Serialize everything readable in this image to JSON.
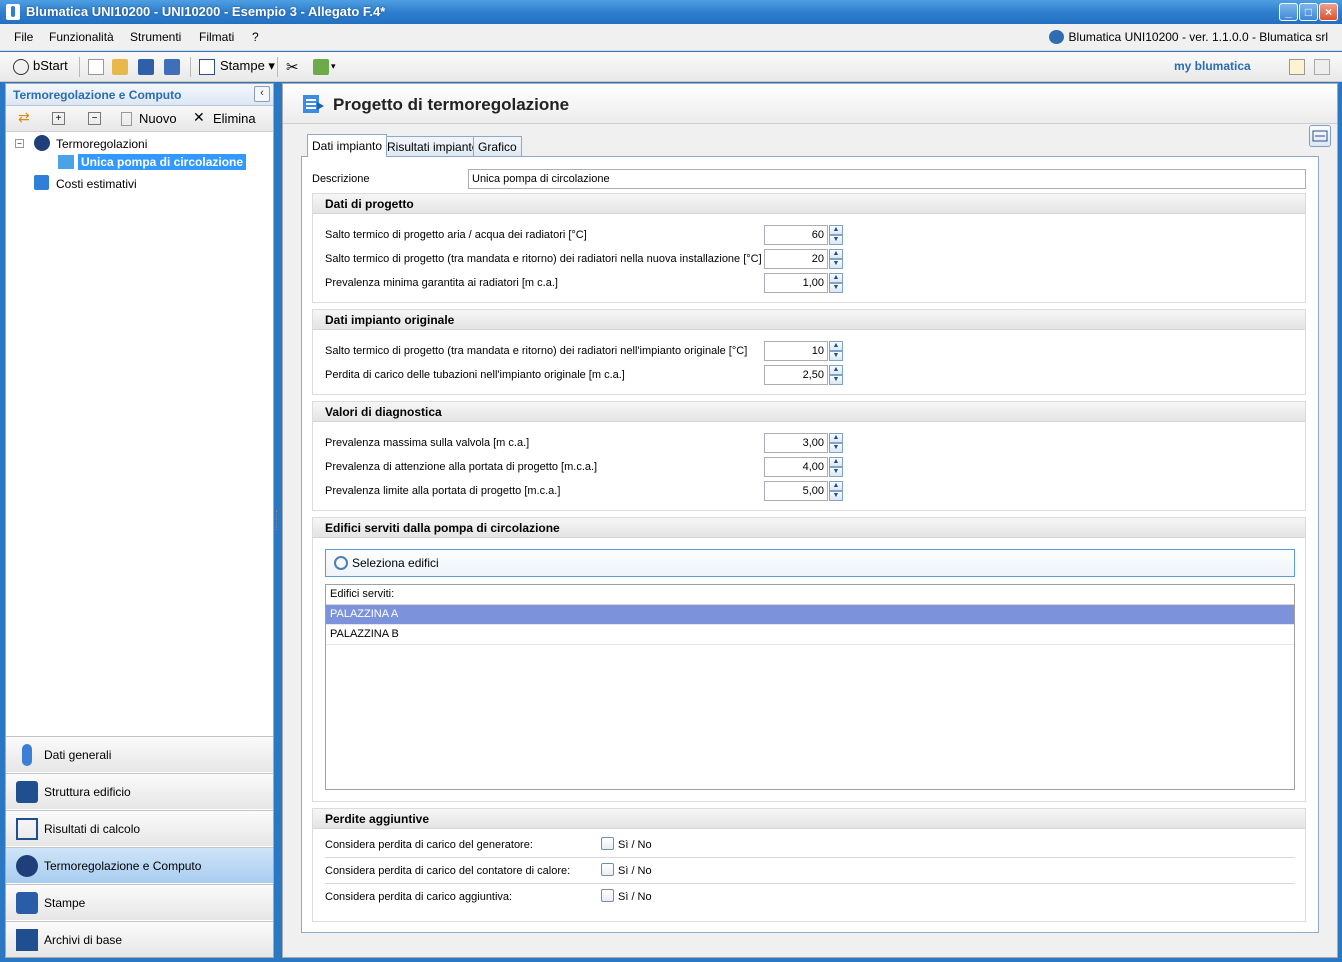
{
  "window": {
    "title": "Blumatica UNI10200 - UNI10200 - Esempio 3 - Allegato F.4*"
  },
  "menu": {
    "items": [
      "File",
      "Funzionalità",
      "Strumenti",
      "Filmati",
      "?"
    ],
    "version": "Blumatica UNI10200 - ver. 1.1.0.0 - Blumatica srl"
  },
  "toolbar": {
    "bstart": "bStart",
    "stampe": "Stampe",
    "brand": "my blumatica"
  },
  "left": {
    "header": "Termoregolazione e Computo",
    "tools": {
      "nuovo": "Nuovo",
      "elimina": "Elimina"
    },
    "tree": {
      "root": "Termoregolazioni",
      "child": "Unica pompa di circolazione",
      "costi": "Costi estimativi"
    },
    "nav": [
      "Dati generali",
      "Struttura edificio",
      "Risultati di calcolo",
      "Termoregolazione e Computo",
      "Stampe",
      "Archivi di base"
    ]
  },
  "main": {
    "title": "Progetto di termoregolazione",
    "tabs": [
      "Dati impianto",
      "Risultati impianto",
      "Grafico"
    ],
    "descrizione": {
      "label": "Descrizione",
      "value": "Unica pompa di circolazione"
    },
    "dati_progetto": {
      "title": "Dati di progetto",
      "rows": [
        {
          "label": "Salto termico di progetto aria / acqua dei radiatori [°C]",
          "value": "60"
        },
        {
          "label": "Salto termico di progetto (tra mandata e ritorno) dei radiatori nella nuova installazione [°C]",
          "value": "20"
        },
        {
          "label": "Prevalenza minima garantita ai radiatori [m c.a.]",
          "value": "1,00"
        }
      ]
    },
    "dati_originale": {
      "title": "Dati impianto originale",
      "rows": [
        {
          "label": "Salto termico di progetto (tra mandata e ritorno) dei radiatori nell'impianto originale [°C]",
          "value": "10"
        },
        {
          "label": "Perdita di carico delle tubazioni nell'impianto originale [m c.a.]",
          "value": "2,50"
        }
      ]
    },
    "diagnostica": {
      "title": "Valori di diagnostica",
      "rows": [
        {
          "label": "Prevalenza massima sulla valvola [m c.a.]",
          "value": "3,00"
        },
        {
          "label": "Prevalenza di attenzione alla portata di progetto [m.c.a.]",
          "value": "4,00"
        },
        {
          "label": "Prevalenza limite alla portata di progetto [m.c.a.]",
          "value": "5,00"
        }
      ]
    },
    "edifici": {
      "title": "Edifici serviti dalla pompa di circolazione",
      "button": "Seleziona edifici",
      "list_header": "Edifici serviti:",
      "items": [
        "PALAZZINA A",
        "PALAZZINA B"
      ]
    },
    "perdite": {
      "title": "Perdite aggiuntive",
      "rows": [
        {
          "label": "Considera perdita di carico del generatore:",
          "check": "Sì / No"
        },
        {
          "label": "Considera perdita di carico del contatore di calore:",
          "check": "Sì / No"
        },
        {
          "label": "Considera perdita di carico aggiuntiva:",
          "check": "Sì / No"
        }
      ]
    }
  }
}
